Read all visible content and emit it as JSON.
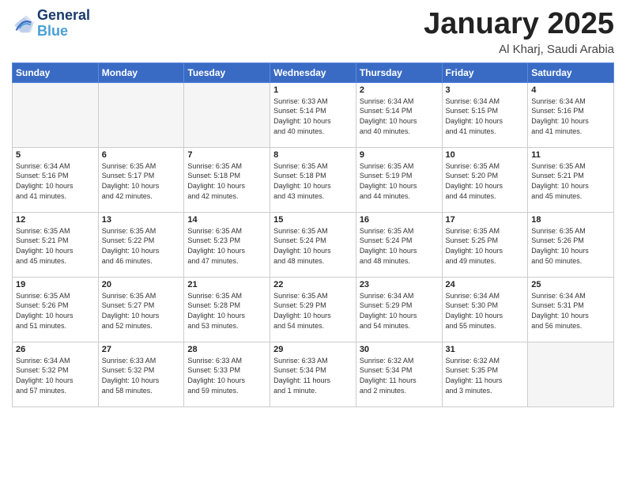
{
  "header": {
    "logo_line1": "General",
    "logo_line2": "Blue",
    "month": "January 2025",
    "location": "Al Kharj, Saudi Arabia"
  },
  "weekdays": [
    "Sunday",
    "Monday",
    "Tuesday",
    "Wednesday",
    "Thursday",
    "Friday",
    "Saturday"
  ],
  "weeks": [
    [
      {
        "day": "",
        "info": ""
      },
      {
        "day": "",
        "info": ""
      },
      {
        "day": "",
        "info": ""
      },
      {
        "day": "1",
        "info": "Sunrise: 6:33 AM\nSunset: 5:14 PM\nDaylight: 10 hours\nand 40 minutes."
      },
      {
        "day": "2",
        "info": "Sunrise: 6:34 AM\nSunset: 5:14 PM\nDaylight: 10 hours\nand 40 minutes."
      },
      {
        "day": "3",
        "info": "Sunrise: 6:34 AM\nSunset: 5:15 PM\nDaylight: 10 hours\nand 41 minutes."
      },
      {
        "day": "4",
        "info": "Sunrise: 6:34 AM\nSunset: 5:16 PM\nDaylight: 10 hours\nand 41 minutes."
      }
    ],
    [
      {
        "day": "5",
        "info": "Sunrise: 6:34 AM\nSunset: 5:16 PM\nDaylight: 10 hours\nand 41 minutes."
      },
      {
        "day": "6",
        "info": "Sunrise: 6:35 AM\nSunset: 5:17 PM\nDaylight: 10 hours\nand 42 minutes."
      },
      {
        "day": "7",
        "info": "Sunrise: 6:35 AM\nSunset: 5:18 PM\nDaylight: 10 hours\nand 42 minutes."
      },
      {
        "day": "8",
        "info": "Sunrise: 6:35 AM\nSunset: 5:18 PM\nDaylight: 10 hours\nand 43 minutes."
      },
      {
        "day": "9",
        "info": "Sunrise: 6:35 AM\nSunset: 5:19 PM\nDaylight: 10 hours\nand 44 minutes."
      },
      {
        "day": "10",
        "info": "Sunrise: 6:35 AM\nSunset: 5:20 PM\nDaylight: 10 hours\nand 44 minutes."
      },
      {
        "day": "11",
        "info": "Sunrise: 6:35 AM\nSunset: 5:21 PM\nDaylight: 10 hours\nand 45 minutes."
      }
    ],
    [
      {
        "day": "12",
        "info": "Sunrise: 6:35 AM\nSunset: 5:21 PM\nDaylight: 10 hours\nand 45 minutes."
      },
      {
        "day": "13",
        "info": "Sunrise: 6:35 AM\nSunset: 5:22 PM\nDaylight: 10 hours\nand 46 minutes."
      },
      {
        "day": "14",
        "info": "Sunrise: 6:35 AM\nSunset: 5:23 PM\nDaylight: 10 hours\nand 47 minutes."
      },
      {
        "day": "15",
        "info": "Sunrise: 6:35 AM\nSunset: 5:24 PM\nDaylight: 10 hours\nand 48 minutes."
      },
      {
        "day": "16",
        "info": "Sunrise: 6:35 AM\nSunset: 5:24 PM\nDaylight: 10 hours\nand 48 minutes."
      },
      {
        "day": "17",
        "info": "Sunrise: 6:35 AM\nSunset: 5:25 PM\nDaylight: 10 hours\nand 49 minutes."
      },
      {
        "day": "18",
        "info": "Sunrise: 6:35 AM\nSunset: 5:26 PM\nDaylight: 10 hours\nand 50 minutes."
      }
    ],
    [
      {
        "day": "19",
        "info": "Sunrise: 6:35 AM\nSunset: 5:26 PM\nDaylight: 10 hours\nand 51 minutes."
      },
      {
        "day": "20",
        "info": "Sunrise: 6:35 AM\nSunset: 5:27 PM\nDaylight: 10 hours\nand 52 minutes."
      },
      {
        "day": "21",
        "info": "Sunrise: 6:35 AM\nSunset: 5:28 PM\nDaylight: 10 hours\nand 53 minutes."
      },
      {
        "day": "22",
        "info": "Sunrise: 6:35 AM\nSunset: 5:29 PM\nDaylight: 10 hours\nand 54 minutes."
      },
      {
        "day": "23",
        "info": "Sunrise: 6:34 AM\nSunset: 5:29 PM\nDaylight: 10 hours\nand 54 minutes."
      },
      {
        "day": "24",
        "info": "Sunrise: 6:34 AM\nSunset: 5:30 PM\nDaylight: 10 hours\nand 55 minutes."
      },
      {
        "day": "25",
        "info": "Sunrise: 6:34 AM\nSunset: 5:31 PM\nDaylight: 10 hours\nand 56 minutes."
      }
    ],
    [
      {
        "day": "26",
        "info": "Sunrise: 6:34 AM\nSunset: 5:32 PM\nDaylight: 10 hours\nand 57 minutes."
      },
      {
        "day": "27",
        "info": "Sunrise: 6:33 AM\nSunset: 5:32 PM\nDaylight: 10 hours\nand 58 minutes."
      },
      {
        "day": "28",
        "info": "Sunrise: 6:33 AM\nSunset: 5:33 PM\nDaylight: 10 hours\nand 59 minutes."
      },
      {
        "day": "29",
        "info": "Sunrise: 6:33 AM\nSunset: 5:34 PM\nDaylight: 11 hours\nand 1 minute."
      },
      {
        "day": "30",
        "info": "Sunrise: 6:32 AM\nSunset: 5:34 PM\nDaylight: 11 hours\nand 2 minutes."
      },
      {
        "day": "31",
        "info": "Sunrise: 6:32 AM\nSunset: 5:35 PM\nDaylight: 11 hours\nand 3 minutes."
      },
      {
        "day": "",
        "info": ""
      }
    ]
  ]
}
